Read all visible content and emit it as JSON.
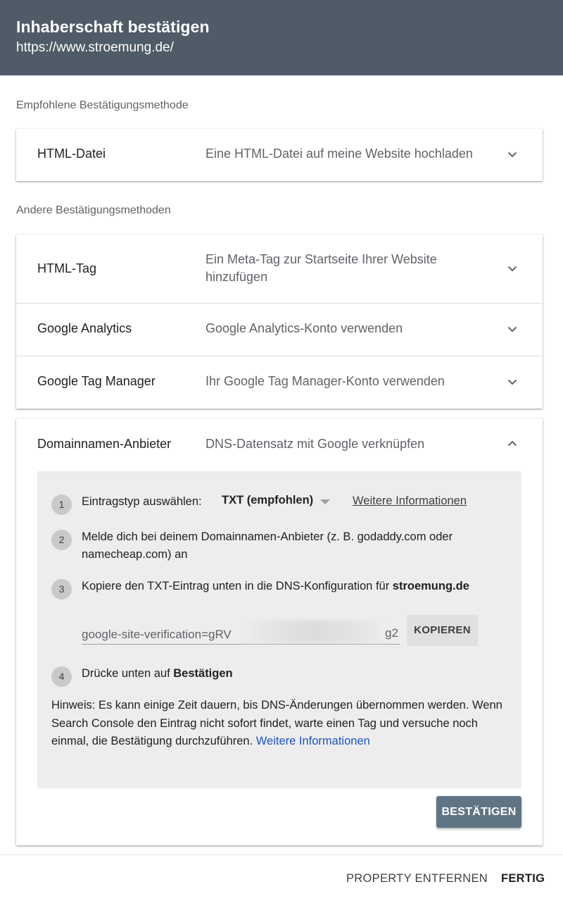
{
  "header": {
    "title": "Inhaberschaft bestätigen",
    "url": "https://www.stroemung.de/"
  },
  "recommended": {
    "label": "Empfohlene Bestätigungsmethode",
    "method": {
      "name": "HTML-Datei",
      "description": "Eine HTML-Datei auf meine Website hochladen"
    }
  },
  "other": {
    "label": "Andere Bestätigungsmethoden",
    "methods": [
      {
        "name": "HTML-Tag",
        "description": "Ein Meta-Tag zur Startseite Ihrer Website hinzufügen"
      },
      {
        "name": "Google Analytics",
        "description": "Google Analytics-Konto verwenden"
      },
      {
        "name": "Google Tag Manager",
        "description": "Ihr Google Tag Manager-Konto verwenden"
      }
    ]
  },
  "domain": {
    "name": "Domainnamen-Anbieter",
    "description": "DNS-Datensatz mit Google verknüpfen",
    "steps": [
      {
        "number": "1",
        "text": "Eintragstyp auswählen:"
      },
      {
        "number": "2",
        "text": "Melde dich bei deinem Domainnamen-Anbieter (z. B. godaddy.com oder namecheap.com) an"
      },
      {
        "number": "3",
        "text": "Kopiere den TXT-Eintrag unten in die DNS-Konfiguration für ",
        "bold": "stroemung.de"
      },
      {
        "number": "4",
        "text": "Drücke unten auf ",
        "bold": "Bestätigen"
      }
    ],
    "record_type": "TXT (empfohlen)",
    "more_info": "Weitere Informationen",
    "verification_prefix": "google-site-verification=gRV",
    "verification_suffix": "g2",
    "copy_label": "KOPIEREN",
    "hint": "Hinweis: Es kann einige Zeit dauern, bis DNS-Änderungen übernommen werden. Wenn Search Console den Eintrag nicht sofort findet, warte einen Tag und versuche noch einmal, die Bestätigung durchzuführen.",
    "hint_link": "Weitere Informationen",
    "confirm_label": "BESTÄTIGEN"
  },
  "footer": {
    "remove_label": "PROPERTY ENTFERNEN",
    "done_label": "FERTIG"
  },
  "colors": {
    "header_bg": "#4f5b66",
    "confirm_bg": "#607584",
    "link": "#1a55c4"
  },
  "icons": {
    "collapsed": "chevron-down-icon",
    "expanded": "chevron-up-icon",
    "dropdown": "caret-down-icon"
  }
}
